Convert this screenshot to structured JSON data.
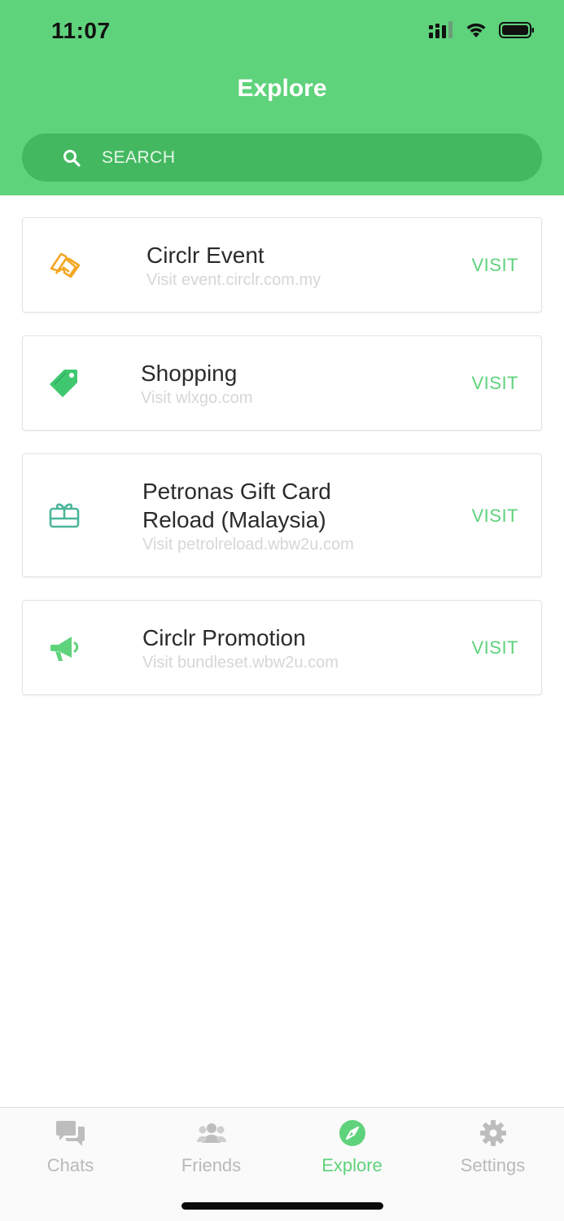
{
  "status_bar": {
    "time": "11:07"
  },
  "header": {
    "title": "Explore"
  },
  "search": {
    "placeholder": "SEARCH",
    "value": ""
  },
  "items": [
    {
      "icon": "ticket-icon",
      "title_lines": [
        "Circlr Event"
      ],
      "subtitle": "Visit event.circlr.com.my",
      "action": "VISIT",
      "icon_color": "#f5a623"
    },
    {
      "icon": "tag-icon",
      "title_lines": [
        "Shopping"
      ],
      "subtitle": "Visit wlxgo.com",
      "action": "VISIT",
      "icon_color": "#3fc870"
    },
    {
      "icon": "gift-card-icon",
      "title_lines": [
        "Petronas Gift Card",
        "Reload (Malaysia)"
      ],
      "subtitle": "Visit petrolreload.wbw2u.com",
      "action": "VISIT",
      "icon_color": "#4ab59a"
    },
    {
      "icon": "megaphone-icon",
      "title_lines": [
        "Circlr Promotion"
      ],
      "subtitle": "Visit bundleset.wbw2u.com",
      "action": "VISIT",
      "icon_color": "#5fd27c"
    }
  ],
  "tabs": [
    {
      "label": "Chats",
      "icon": "chat-bubbles-icon",
      "active": false
    },
    {
      "label": "Friends",
      "icon": "people-icon",
      "active": false
    },
    {
      "label": "Explore",
      "icon": "compass-icon",
      "active": true
    },
    {
      "label": "Settings",
      "icon": "gear-icon",
      "active": false
    }
  ],
  "colors": {
    "brand": "#5fd27c",
    "search_bg": "#44b860",
    "inactive": "#b9b9b9",
    "subtitle": "#d6d6d6"
  }
}
